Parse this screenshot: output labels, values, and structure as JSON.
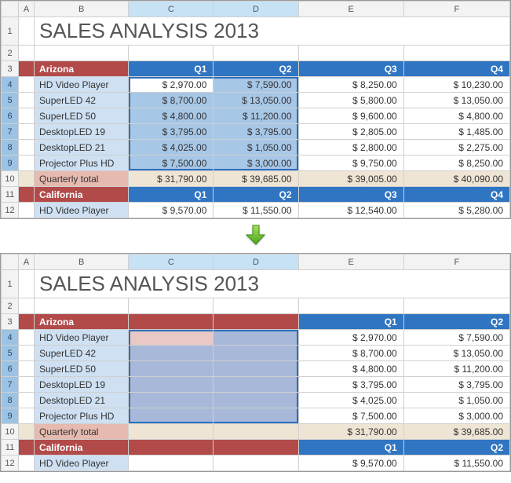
{
  "columns": [
    "A",
    "B",
    "C",
    "D",
    "E",
    "F"
  ],
  "rows": [
    "1",
    "2",
    "3",
    "4",
    "5",
    "6",
    "7",
    "8",
    "9",
    "10",
    "11",
    "12"
  ],
  "title": "SALES ANALYSIS 2013",
  "sheet1": {
    "state1": "Arizona",
    "state2": "California",
    "quarters": {
      "q1": "Q1",
      "q2": "Q2",
      "q3": "Q3",
      "q4": "Q4"
    },
    "products": [
      "HD Video Player",
      "SuperLED 42",
      "SuperLED 50",
      "DesktopLED 19",
      "DesktopLED 21",
      "Projector Plus HD"
    ],
    "data": [
      [
        "$ 2,970.00",
        "$ 7,590.00",
        "$ 8,250.00",
        "$ 10,230.00"
      ],
      [
        "$ 8,700.00",
        "$ 13,050.00",
        "$ 5,800.00",
        "$ 13,050.00"
      ],
      [
        "$ 4,800.00",
        "$ 11,200.00",
        "$ 9,600.00",
        "$ 4,800.00"
      ],
      [
        "$ 3,795.00",
        "$ 3,795.00",
        "$ 2,805.00",
        "$ 1,485.00"
      ],
      [
        "$ 4,025.00",
        "$ 1,050.00",
        "$ 2,800.00",
        "$ 2,275.00"
      ],
      [
        "$ 7,500.00",
        "$ 3,000.00",
        "$ 9,750.00",
        "$ 8,250.00"
      ]
    ],
    "total_label": "Quarterly total",
    "totals": [
      "$ 31,790.00",
      "$ 39,685.00",
      "$ 39,005.00",
      "$ 40,090.00"
    ],
    "cal_row": [
      "$ 9,570.00",
      "$ 11,550.00",
      "$ 12,540.00",
      "$ 5,280.00"
    ],
    "cal_product": "HD Video Player"
  },
  "sheet2": {
    "state1": "Arizona",
    "state2": "California",
    "quarters": {
      "q1": "Q1",
      "q2": "Q2"
    },
    "products": [
      "HD Video Player",
      "SuperLED 42",
      "SuperLED 50",
      "DesktopLED 19",
      "DesktopLED 21",
      "Projector Plus HD"
    ],
    "data": [
      [
        "$ 2,970.00",
        "$ 7,590.00"
      ],
      [
        "$ 8,700.00",
        "$ 13,050.00"
      ],
      [
        "$ 4,800.00",
        "$ 11,200.00"
      ],
      [
        "$ 3,795.00",
        "$ 3,795.00"
      ],
      [
        "$ 4,025.00",
        "$ 1,050.00"
      ],
      [
        "$ 7,500.00",
        "$ 3,000.00"
      ]
    ],
    "total_label": "Quarterly total",
    "totals": [
      "$ 31,790.00",
      "$ 39,685.00"
    ],
    "cal_row": [
      "$ 9,570.00",
      "$ 11,550.00"
    ],
    "cal_product": "HD Video Player"
  },
  "chart_data": {
    "type": "table",
    "title": "SALES ANALYSIS 2013",
    "regions": [
      {
        "name": "Arizona",
        "rows": [
          {
            "product": "HD Video Player",
            "Q1": 2970,
            "Q2": 7590,
            "Q3": 8250,
            "Q4": 10230
          },
          {
            "product": "SuperLED 42",
            "Q1": 8700,
            "Q2": 13050,
            "Q3": 5800,
            "Q4": 13050
          },
          {
            "product": "SuperLED 50",
            "Q1": 4800,
            "Q2": 11200,
            "Q3": 9600,
            "Q4": 4800
          },
          {
            "product": "DesktopLED 19",
            "Q1": 3795,
            "Q2": 3795,
            "Q3": 2805,
            "Q4": 1485
          },
          {
            "product": "DesktopLED 21",
            "Q1": 4025,
            "Q2": 1050,
            "Q3": 2800,
            "Q4": 2275
          },
          {
            "product": "Projector Plus HD",
            "Q1": 7500,
            "Q2": 3000,
            "Q3": 9750,
            "Q4": 8250
          }
        ],
        "totals": {
          "Q1": 31790,
          "Q2": 39685,
          "Q3": 39005,
          "Q4": 40090
        }
      },
      {
        "name": "California",
        "rows": [
          {
            "product": "HD Video Player",
            "Q1": 9570,
            "Q2": 11550,
            "Q3": 12540,
            "Q4": 5280
          }
        ]
      }
    ]
  }
}
